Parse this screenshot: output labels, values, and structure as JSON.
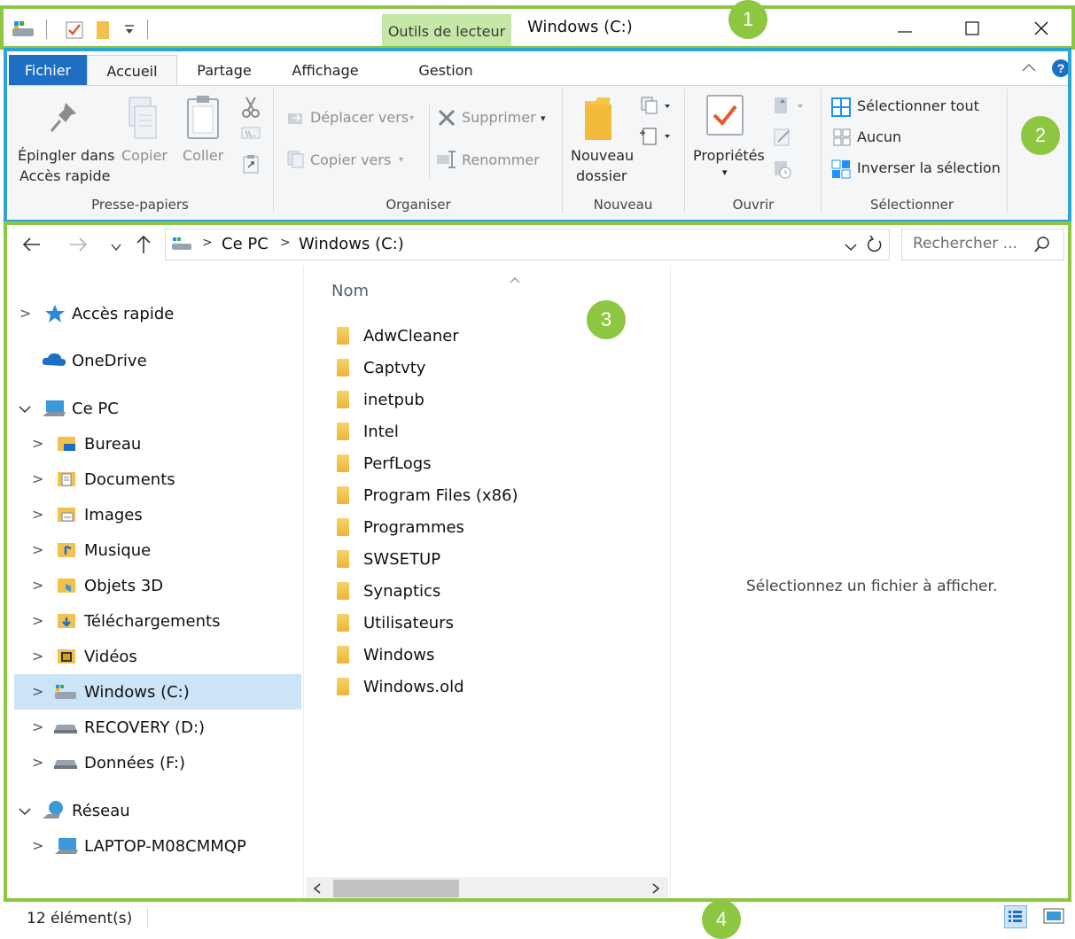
{
  "titlebar": {
    "contextual_tab": "Outils de lecteur",
    "title": "Windows (C:)"
  },
  "ribbon": {
    "tabs": [
      "Fichier",
      "Accueil",
      "Partage",
      "Affichage",
      "Gestion"
    ],
    "clipboard": {
      "pin_line1": "Épingler dans",
      "pin_line2": "Accès rapide",
      "copy": "Copier",
      "paste": "Coller",
      "group": "Presse-papiers"
    },
    "organize": {
      "move_to": "Déplacer vers",
      "copy_to": "Copier vers",
      "delete": "Supprimer",
      "rename": "Renommer",
      "group": "Organiser"
    },
    "new": {
      "folder_line1": "Nouveau",
      "folder_line2": "dossier",
      "group": "Nouveau"
    },
    "open": {
      "properties": "Propriétés",
      "group": "Ouvrir"
    },
    "select": {
      "select_all": "Sélectionner tout",
      "none": "Aucun",
      "invert": "Inverser la sélection",
      "group": "Sélectionner"
    }
  },
  "address": {
    "crumbs": [
      "Ce PC",
      "Windows (C:)"
    ],
    "search_placeholder": "Rechercher ..."
  },
  "nav": {
    "quick_access": "Accès rapide",
    "onedrive": "OneDrive",
    "this_pc": "Ce PC",
    "pc_items": [
      "Bureau",
      "Documents",
      "Images",
      "Musique",
      "Objets 3D",
      "Téléchargements",
      "Vidéos",
      "Windows (C:)",
      "RECOVERY (D:)",
      "Données (F:)"
    ],
    "network": "Réseau",
    "network_items": [
      "LAPTOP-M08CMMQP"
    ]
  },
  "files": {
    "column_name": "Nom",
    "items": [
      "AdwCleaner",
      "Captvty",
      "inetpub",
      "Intel",
      "PerfLogs",
      "Program Files (x86)",
      "Programmes",
      "SWSETUP",
      "Synaptics",
      "Utilisateurs",
      "Windows",
      "Windows.old"
    ]
  },
  "preview": {
    "empty_text": "Sélectionnez un fichier à afficher."
  },
  "status": {
    "count": "12 élément(s)"
  },
  "badges": [
    "1",
    "2",
    "3",
    "4"
  ],
  "colors": {
    "accent_green": "#8dc641",
    "accent_blue": "#1e6fc3",
    "selection": "#cce4f7"
  }
}
